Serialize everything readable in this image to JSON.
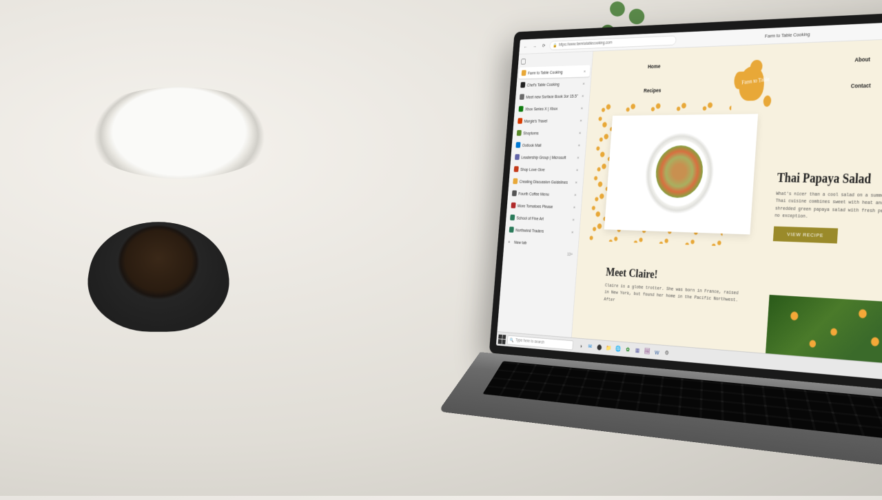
{
  "browser": {
    "url": "https://www.farmtotablecooking.com",
    "window_title": "Farm to Table Cooking",
    "nav": {
      "back": "←",
      "forward": "→",
      "refresh": "⟳"
    },
    "actions": {
      "favorite": "☆",
      "collections": "⧉",
      "profile": "◐"
    },
    "win": {
      "min": "–",
      "max": "□",
      "close": "×"
    }
  },
  "tabs": {
    "count_label": "13+",
    "newtab_label": "New tab",
    "items": [
      {
        "label": "Farm to Table Cooking",
        "color": "#e8a838",
        "active": true
      },
      {
        "label": "Chef's Table Cooking",
        "color": "#222222"
      },
      {
        "label": "Meet new Surface Book 3or 15.5\"",
        "color": "#6a6a6a"
      },
      {
        "label": "Xbox Series X | Xbox",
        "color": "#107c10"
      },
      {
        "label": "Margie's Travel",
        "color": "#d83b01"
      },
      {
        "label": "Shoptoms",
        "color": "#5a8a2a"
      },
      {
        "label": "Outlook Mail",
        "color": "#0078d4"
      },
      {
        "label": "Leadership Group | Microsoft",
        "color": "#6264a7"
      },
      {
        "label": "Shop Love Give",
        "color": "#c43a1a"
      },
      {
        "label": "Creating Discussion Guidelines",
        "color": "#e8a838"
      },
      {
        "label": "Fourth Coffee Menu",
        "color": "#555555"
      },
      {
        "label": "More Tomatoes Please",
        "color": "#b02a2a"
      },
      {
        "label": "School of Fine Art",
        "color": "#2a7a5a"
      },
      {
        "label": "Northwind Traders",
        "color": "#2a7a5a"
      }
    ]
  },
  "site": {
    "nav": {
      "home": "Home",
      "recipes": "Recipes",
      "about": "About",
      "contact": "Contact"
    },
    "logo_text": "Farm to Table",
    "recipe": {
      "title": "Thai Papaya Salad",
      "desc": "What's nicer than a cool salad on a summer day? Thai cuisine combines sweet with heat and this shredded green papaya salad with fresh peppers is no exception.",
      "button": "VIEW RECIPE"
    },
    "meet": {
      "title": "Meet Claire!",
      "desc": "Claire is a globe trotter. She was born in France, raised in New York, but found her home in the Pacific Northwest. After"
    }
  },
  "taskbar": {
    "search_placeholder": "Type here to search",
    "icons": [
      "◑",
      "✉",
      "⬤",
      "📁",
      "🌐",
      "✿",
      "▦",
      "🖼",
      "W",
      "⚙"
    ]
  }
}
